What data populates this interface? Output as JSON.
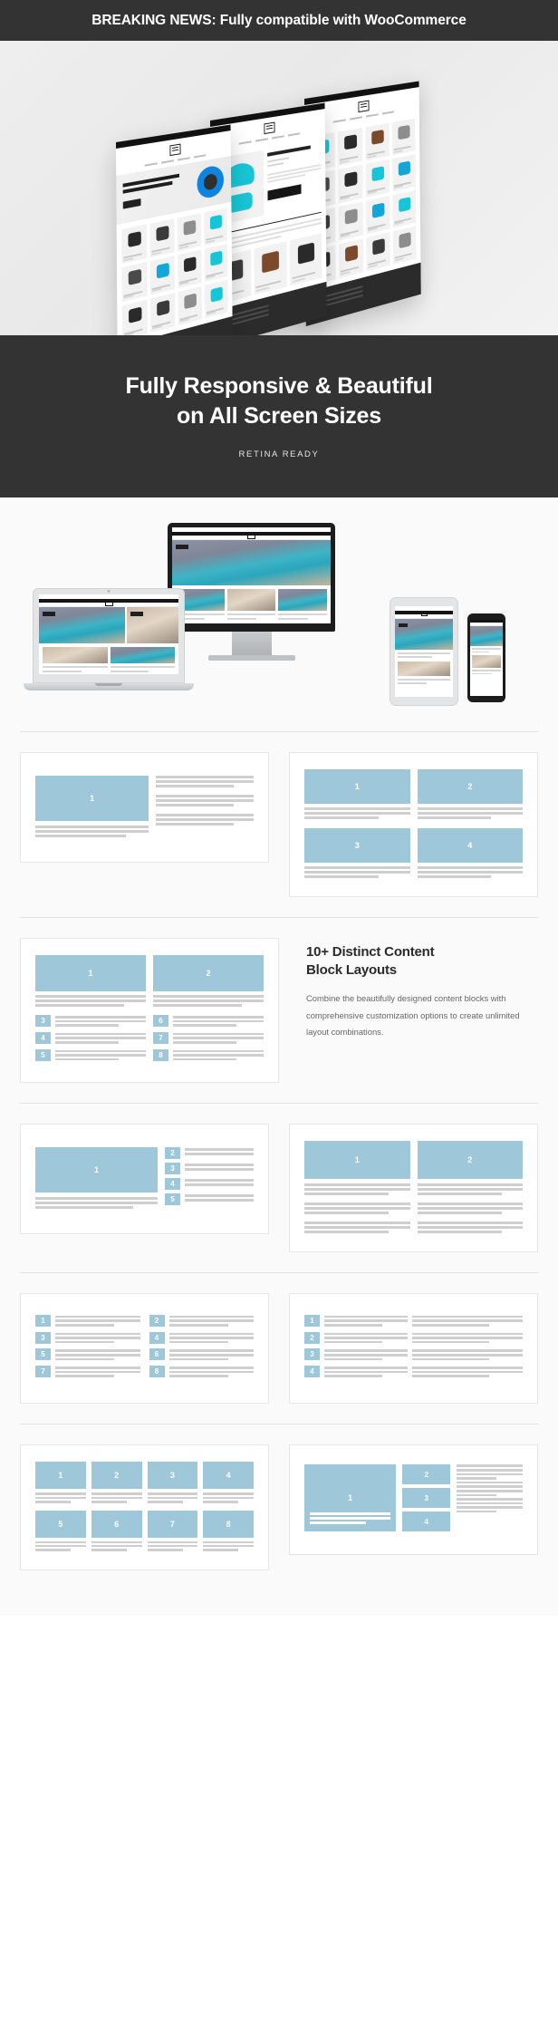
{
  "breaking": {
    "text": "BREAKING NEWS: Fully compatible with WooCommerce"
  },
  "hero": {
    "alt": "three angled website screen mockups"
  },
  "band": {
    "line1": "Fully Responsive & Beautiful",
    "line2": "on All Screen Sizes",
    "subtitle": "RETINA READY"
  },
  "devices": {
    "alt": "imac, laptop, tablet and phone device mockups"
  },
  "feature": {
    "heading_line1": "10+ Distinct Content",
    "heading_line2": "Block Layouts",
    "body": "Combine the beautifully designed content blocks with comprehensive customization options to create unlimited layout combinations."
  },
  "colors": {
    "dark": "#333333",
    "block_blue": "#9fc7da",
    "line_grey": "#cfcfcf",
    "page_bg": "#fafafa",
    "card_border": "#e6e6e6"
  },
  "layouts": [
    {
      "id": "layout-1-image-left-text-right",
      "blocks": [
        "1"
      ]
    },
    {
      "id": "layout-2-four-card-grid",
      "blocks": [
        "1",
        "2",
        "3",
        "4"
      ]
    },
    {
      "id": "layout-3-two-feature-two-lists",
      "blocks": [
        "1",
        "2",
        "3",
        "4",
        "5",
        "6",
        "7",
        "8"
      ]
    },
    {
      "id": "layout-4-feature-plus-list",
      "blocks": [
        "1",
        "2",
        "3",
        "4",
        "5"
      ]
    },
    {
      "id": "layout-5-two-column-articles",
      "blocks": [
        "1",
        "2"
      ]
    },
    {
      "id": "layout-6-two-column-eight-list",
      "blocks": [
        "1",
        "2",
        "3",
        "4",
        "5",
        "6",
        "7",
        "8"
      ]
    },
    {
      "id": "layout-7-four-item-list",
      "blocks": [
        "1",
        "2",
        "3",
        "4"
      ]
    },
    {
      "id": "layout-8-eight-card-grid",
      "blocks": [
        "1",
        "2",
        "3",
        "4",
        "5",
        "6",
        "7",
        "8"
      ]
    },
    {
      "id": "layout-9-featured-plus-stack",
      "blocks": [
        "1",
        "2",
        "3",
        "4"
      ]
    }
  ]
}
